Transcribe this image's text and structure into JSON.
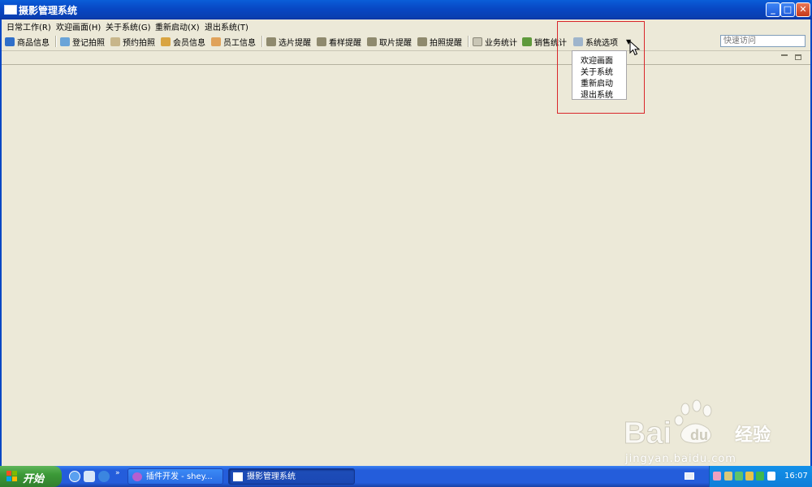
{
  "window": {
    "title": "摄影管理系统"
  },
  "menubar": {
    "items": [
      "日常工作(R)",
      "欢迎画面(H)",
      "关于系统(G)",
      "重新启动(X)",
      "退出系统(T)"
    ]
  },
  "toolbar": {
    "items": [
      "商品信息",
      "登记拍照",
      "预约拍照",
      "会员信息",
      "员工信息",
      "选片提醒",
      "看样提醒",
      "取片提醒",
      "拍照提醒",
      "业务统计",
      "销售统计",
      "系统选项"
    ],
    "quick_search_placeholder": "快速访问"
  },
  "dropdown": {
    "items": [
      "欢迎画面",
      "关于系统",
      "重新启动",
      "退出系统"
    ]
  },
  "watermark": {
    "logo_text": "Baidu",
    "cn": "经验",
    "url": "jingyan.baidu.com"
  },
  "taskbar": {
    "start_label": "开始",
    "tasks": [
      "插件开发 - shey...",
      "摄影管理系统"
    ],
    "clock": "16:07"
  },
  "colors": {
    "titlebar": "#0847c4",
    "highlight_box": "#d9262a",
    "background": "#ece9d8",
    "taskbar": "#245ddb"
  }
}
